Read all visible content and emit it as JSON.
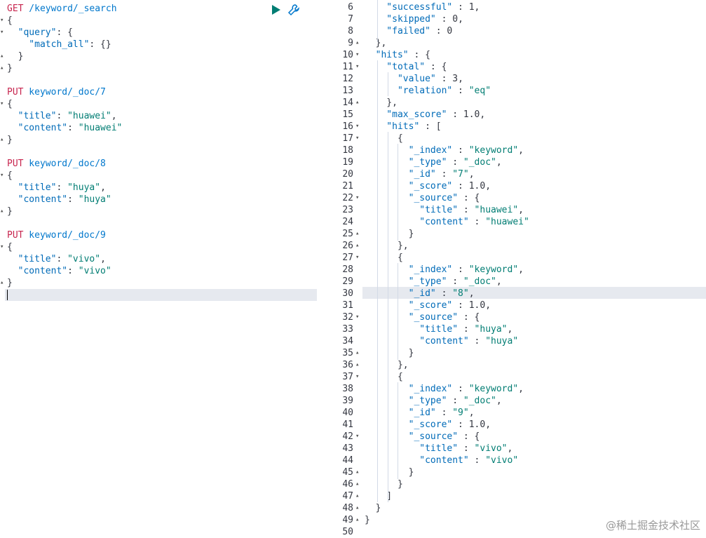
{
  "request_editor": {
    "lines": [
      {
        "parts": [
          {
            "c": "method",
            "t": "GET"
          },
          {
            "c": "path",
            "t": " /keyword/_search"
          }
        ]
      },
      {
        "parts": [
          {
            "c": "punc",
            "t": "{"
          }
        ]
      },
      {
        "parts": [
          {
            "c": "key",
            "t": "  \"query\""
          },
          {
            "c": "punc",
            "t": ": {"
          }
        ]
      },
      {
        "parts": [
          {
            "c": "key",
            "t": "    \"match_all\""
          },
          {
            "c": "punc",
            "t": ": {}"
          }
        ]
      },
      {
        "parts": [
          {
            "c": "punc",
            "t": "  }"
          }
        ]
      },
      {
        "parts": [
          {
            "c": "punc",
            "t": "}"
          }
        ]
      },
      {
        "parts": []
      },
      {
        "parts": [
          {
            "c": "method",
            "t": "PUT"
          },
          {
            "c": "path",
            "t": " keyword/_doc/7"
          }
        ]
      },
      {
        "parts": [
          {
            "c": "punc",
            "t": "{"
          }
        ]
      },
      {
        "parts": [
          {
            "c": "key",
            "t": "  \"title\""
          },
          {
            "c": "punc",
            "t": ": "
          },
          {
            "c": "str",
            "t": "\"huawei\""
          },
          {
            "c": "punc",
            "t": ","
          }
        ]
      },
      {
        "parts": [
          {
            "c": "key",
            "t": "  \"content\""
          },
          {
            "c": "punc",
            "t": ": "
          },
          {
            "c": "str",
            "t": "\"huawei\""
          }
        ]
      },
      {
        "parts": [
          {
            "c": "punc",
            "t": "}"
          }
        ]
      },
      {
        "parts": []
      },
      {
        "parts": [
          {
            "c": "method",
            "t": "PUT"
          },
          {
            "c": "path",
            "t": " keyword/_doc/8"
          }
        ]
      },
      {
        "parts": [
          {
            "c": "punc",
            "t": "{"
          }
        ]
      },
      {
        "parts": [
          {
            "c": "key",
            "t": "  \"title\""
          },
          {
            "c": "punc",
            "t": ": "
          },
          {
            "c": "str",
            "t": "\"huya\""
          },
          {
            "c": "punc",
            "t": ","
          }
        ]
      },
      {
        "parts": [
          {
            "c": "key",
            "t": "  \"content\""
          },
          {
            "c": "punc",
            "t": ": "
          },
          {
            "c": "str",
            "t": "\"huya\""
          }
        ]
      },
      {
        "parts": [
          {
            "c": "punc",
            "t": "}"
          }
        ]
      },
      {
        "parts": []
      },
      {
        "parts": [
          {
            "c": "method",
            "t": "PUT"
          },
          {
            "c": "path",
            "t": " keyword/_doc/9"
          }
        ]
      },
      {
        "parts": [
          {
            "c": "punc",
            "t": "{"
          }
        ]
      },
      {
        "parts": [
          {
            "c": "key",
            "t": "  \"title\""
          },
          {
            "c": "punc",
            "t": ": "
          },
          {
            "c": "str",
            "t": "\"vivo\""
          },
          {
            "c": "punc",
            "t": ","
          }
        ]
      },
      {
        "parts": [
          {
            "c": "key",
            "t": "  \"content\""
          },
          {
            "c": "punc",
            "t": ": "
          },
          {
            "c": "str",
            "t": "\"vivo\""
          }
        ]
      },
      {
        "parts": [
          {
            "c": "punc",
            "t": "}"
          }
        ]
      }
    ],
    "folds": [
      "",
      "▾",
      "▾",
      "",
      "▴",
      "▴",
      "",
      "",
      "▾",
      "",
      "",
      "▴",
      "",
      "",
      "▾",
      "",
      "",
      "▴",
      "",
      "",
      "▾",
      "",
      "",
      "▴"
    ]
  },
  "actions": {
    "run_label": "Send request",
    "settings_label": "Settings"
  },
  "response_editor": {
    "lines": [
      {
        "n": "6",
        "f": "",
        "parts": [
          {
            "c": "key",
            "t": "    \"successful\""
          },
          {
            "c": "punc",
            "t": " : "
          },
          {
            "c": "num",
            "t": "1"
          },
          {
            "c": "punc",
            "t": ","
          }
        ]
      },
      {
        "n": "7",
        "f": "",
        "parts": [
          {
            "c": "key",
            "t": "    \"skipped\""
          },
          {
            "c": "punc",
            "t": " : "
          },
          {
            "c": "num",
            "t": "0"
          },
          {
            "c": "punc",
            "t": ","
          }
        ]
      },
      {
        "n": "8",
        "f": "",
        "parts": [
          {
            "c": "key",
            "t": "    \"failed\""
          },
          {
            "c": "punc",
            "t": " : "
          },
          {
            "c": "num",
            "t": "0"
          }
        ]
      },
      {
        "n": "9",
        "f": "▴",
        "parts": [
          {
            "c": "punc",
            "t": "  },"
          }
        ]
      },
      {
        "n": "10",
        "f": "▾",
        "parts": [
          {
            "c": "key",
            "t": "  \"hits\""
          },
          {
            "c": "punc",
            "t": " : {"
          }
        ]
      },
      {
        "n": "11",
        "f": "▾",
        "parts": [
          {
            "c": "key",
            "t": "    \"total\""
          },
          {
            "c": "punc",
            "t": " : {"
          }
        ]
      },
      {
        "n": "12",
        "f": "",
        "parts": [
          {
            "c": "key",
            "t": "      \"value\""
          },
          {
            "c": "punc",
            "t": " : "
          },
          {
            "c": "num",
            "t": "3"
          },
          {
            "c": "punc",
            "t": ","
          }
        ]
      },
      {
        "n": "13",
        "f": "",
        "parts": [
          {
            "c": "key",
            "t": "      \"relation\""
          },
          {
            "c": "punc",
            "t": " : "
          },
          {
            "c": "str",
            "t": "\"eq\""
          }
        ]
      },
      {
        "n": "14",
        "f": "▴",
        "parts": [
          {
            "c": "punc",
            "t": "    },"
          }
        ]
      },
      {
        "n": "15",
        "f": "",
        "parts": [
          {
            "c": "key",
            "t": "    \"max_score\""
          },
          {
            "c": "punc",
            "t": " : "
          },
          {
            "c": "num",
            "t": "1.0"
          },
          {
            "c": "punc",
            "t": ","
          }
        ]
      },
      {
        "n": "16",
        "f": "▾",
        "parts": [
          {
            "c": "key",
            "t": "    \"hits\""
          },
          {
            "c": "punc",
            "t": " : ["
          }
        ]
      },
      {
        "n": "17",
        "f": "▾",
        "parts": [
          {
            "c": "punc",
            "t": "      {"
          }
        ]
      },
      {
        "n": "18",
        "f": "",
        "parts": [
          {
            "c": "key",
            "t": "        \"_index\""
          },
          {
            "c": "punc",
            "t": " : "
          },
          {
            "c": "str",
            "t": "\"keyword\""
          },
          {
            "c": "punc",
            "t": ","
          }
        ]
      },
      {
        "n": "19",
        "f": "",
        "parts": [
          {
            "c": "key",
            "t": "        \"_type\""
          },
          {
            "c": "punc",
            "t": " : "
          },
          {
            "c": "str",
            "t": "\"_doc\""
          },
          {
            "c": "punc",
            "t": ","
          }
        ]
      },
      {
        "n": "20",
        "f": "",
        "parts": [
          {
            "c": "key",
            "t": "        \"_id\""
          },
          {
            "c": "punc",
            "t": " : "
          },
          {
            "c": "str",
            "t": "\"7\""
          },
          {
            "c": "punc",
            "t": ","
          }
        ]
      },
      {
        "n": "21",
        "f": "",
        "parts": [
          {
            "c": "key",
            "t": "        \"_score\""
          },
          {
            "c": "punc",
            "t": " : "
          },
          {
            "c": "num",
            "t": "1.0"
          },
          {
            "c": "punc",
            "t": ","
          }
        ]
      },
      {
        "n": "22",
        "f": "▾",
        "parts": [
          {
            "c": "key",
            "t": "        \"_source\""
          },
          {
            "c": "punc",
            "t": " : {"
          }
        ]
      },
      {
        "n": "23",
        "f": "",
        "parts": [
          {
            "c": "key",
            "t": "          \"title\""
          },
          {
            "c": "punc",
            "t": " : "
          },
          {
            "c": "str",
            "t": "\"huawei\""
          },
          {
            "c": "punc",
            "t": ","
          }
        ]
      },
      {
        "n": "24",
        "f": "",
        "parts": [
          {
            "c": "key",
            "t": "          \"content\""
          },
          {
            "c": "punc",
            "t": " : "
          },
          {
            "c": "str",
            "t": "\"huawei\""
          }
        ]
      },
      {
        "n": "25",
        "f": "▴",
        "parts": [
          {
            "c": "punc",
            "t": "        }"
          }
        ]
      },
      {
        "n": "26",
        "f": "▴",
        "parts": [
          {
            "c": "punc",
            "t": "      },"
          }
        ]
      },
      {
        "n": "27",
        "f": "▾",
        "parts": [
          {
            "c": "punc",
            "t": "      {"
          }
        ]
      },
      {
        "n": "28",
        "f": "",
        "parts": [
          {
            "c": "key",
            "t": "        \"_index\""
          },
          {
            "c": "punc",
            "t": " : "
          },
          {
            "c": "str",
            "t": "\"keyword\""
          },
          {
            "c": "punc",
            "t": ","
          }
        ]
      },
      {
        "n": "29",
        "f": "",
        "parts": [
          {
            "c": "key",
            "t": "        \"_type\""
          },
          {
            "c": "punc",
            "t": " : "
          },
          {
            "c": "str",
            "t": "\"_doc\""
          },
          {
            "c": "punc",
            "t": ","
          }
        ]
      },
      {
        "n": "30",
        "f": "",
        "parts": [
          {
            "c": "key",
            "t": "        \"_id\""
          },
          {
            "c": "punc",
            "t": " : "
          },
          {
            "c": "str",
            "t": "\"8\""
          },
          {
            "c": "punc",
            "t": ","
          }
        ]
      },
      {
        "n": "31",
        "f": "",
        "parts": [
          {
            "c": "key",
            "t": "        \"_score\""
          },
          {
            "c": "punc",
            "t": " : "
          },
          {
            "c": "num",
            "t": "1.0"
          },
          {
            "c": "punc",
            "t": ","
          }
        ]
      },
      {
        "n": "32",
        "f": "▾",
        "parts": [
          {
            "c": "key",
            "t": "        \"_source\""
          },
          {
            "c": "punc",
            "t": " : {"
          }
        ]
      },
      {
        "n": "33",
        "f": "",
        "parts": [
          {
            "c": "key",
            "t": "          \"title\""
          },
          {
            "c": "punc",
            "t": " : "
          },
          {
            "c": "str",
            "t": "\"huya\""
          },
          {
            "c": "punc",
            "t": ","
          }
        ]
      },
      {
        "n": "34",
        "f": "",
        "parts": [
          {
            "c": "key",
            "t": "          \"content\""
          },
          {
            "c": "punc",
            "t": " : "
          },
          {
            "c": "str",
            "t": "\"huya\""
          }
        ]
      },
      {
        "n": "35",
        "f": "▴",
        "parts": [
          {
            "c": "punc",
            "t": "        }"
          }
        ]
      },
      {
        "n": "36",
        "f": "▴",
        "parts": [
          {
            "c": "punc",
            "t": "      },"
          }
        ]
      },
      {
        "n": "37",
        "f": "▾",
        "parts": [
          {
            "c": "punc",
            "t": "      {"
          }
        ]
      },
      {
        "n": "38",
        "f": "",
        "parts": [
          {
            "c": "key",
            "t": "        \"_index\""
          },
          {
            "c": "punc",
            "t": " : "
          },
          {
            "c": "str",
            "t": "\"keyword\""
          },
          {
            "c": "punc",
            "t": ","
          }
        ]
      },
      {
        "n": "39",
        "f": "",
        "parts": [
          {
            "c": "key",
            "t": "        \"_type\""
          },
          {
            "c": "punc",
            "t": " : "
          },
          {
            "c": "str",
            "t": "\"_doc\""
          },
          {
            "c": "punc",
            "t": ","
          }
        ]
      },
      {
        "n": "40",
        "f": "",
        "parts": [
          {
            "c": "key",
            "t": "        \"_id\""
          },
          {
            "c": "punc",
            "t": " : "
          },
          {
            "c": "str",
            "t": "\"9\""
          },
          {
            "c": "punc",
            "t": ","
          }
        ]
      },
      {
        "n": "41",
        "f": "",
        "parts": [
          {
            "c": "key",
            "t": "        \"_score\""
          },
          {
            "c": "punc",
            "t": " : "
          },
          {
            "c": "num",
            "t": "1.0"
          },
          {
            "c": "punc",
            "t": ","
          }
        ]
      },
      {
        "n": "42",
        "f": "▾",
        "parts": [
          {
            "c": "key",
            "t": "        \"_source\""
          },
          {
            "c": "punc",
            "t": " : {"
          }
        ]
      },
      {
        "n": "43",
        "f": "",
        "parts": [
          {
            "c": "key",
            "t": "          \"title\""
          },
          {
            "c": "punc",
            "t": " : "
          },
          {
            "c": "str",
            "t": "\"vivo\""
          },
          {
            "c": "punc",
            "t": ","
          }
        ]
      },
      {
        "n": "44",
        "f": "",
        "parts": [
          {
            "c": "key",
            "t": "          \"content\""
          },
          {
            "c": "punc",
            "t": " : "
          },
          {
            "c": "str",
            "t": "\"vivo\""
          }
        ]
      },
      {
        "n": "45",
        "f": "▴",
        "parts": [
          {
            "c": "punc",
            "t": "        }"
          }
        ]
      },
      {
        "n": "46",
        "f": "▴",
        "parts": [
          {
            "c": "punc",
            "t": "      }"
          }
        ]
      },
      {
        "n": "47",
        "f": "▴",
        "parts": [
          {
            "c": "punc",
            "t": "    ]"
          }
        ]
      },
      {
        "n": "48",
        "f": "▴",
        "parts": [
          {
            "c": "punc",
            "t": "  }"
          }
        ]
      },
      {
        "n": "49",
        "f": "▴",
        "parts": [
          {
            "c": "punc",
            "t": "}"
          }
        ]
      },
      {
        "n": "50",
        "f": "",
        "parts": []
      }
    ]
  },
  "colors": {
    "method": "#c7254e",
    "path": "#0077cc",
    "key": "#006bb8",
    "string": "#017d73",
    "run": "#017d73"
  },
  "watermark": "@稀土掘金技术社区"
}
